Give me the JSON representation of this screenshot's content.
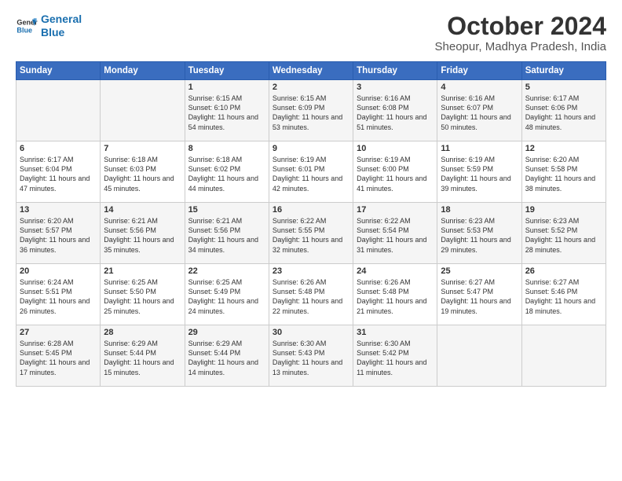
{
  "logo": {
    "line1": "General",
    "line2": "Blue"
  },
  "title": "October 2024",
  "location": "Sheopur, Madhya Pradesh, India",
  "days_of_week": [
    "Sunday",
    "Monday",
    "Tuesday",
    "Wednesday",
    "Thursday",
    "Friday",
    "Saturday"
  ],
  "weeks": [
    [
      {
        "day": "",
        "sunrise": "",
        "sunset": "",
        "daylight": ""
      },
      {
        "day": "",
        "sunrise": "",
        "sunset": "",
        "daylight": ""
      },
      {
        "day": "1",
        "sunrise": "Sunrise: 6:15 AM",
        "sunset": "Sunset: 6:10 PM",
        "daylight": "Daylight: 11 hours and 54 minutes."
      },
      {
        "day": "2",
        "sunrise": "Sunrise: 6:15 AM",
        "sunset": "Sunset: 6:09 PM",
        "daylight": "Daylight: 11 hours and 53 minutes."
      },
      {
        "day": "3",
        "sunrise": "Sunrise: 6:16 AM",
        "sunset": "Sunset: 6:08 PM",
        "daylight": "Daylight: 11 hours and 51 minutes."
      },
      {
        "day": "4",
        "sunrise": "Sunrise: 6:16 AM",
        "sunset": "Sunset: 6:07 PM",
        "daylight": "Daylight: 11 hours and 50 minutes."
      },
      {
        "day": "5",
        "sunrise": "Sunrise: 6:17 AM",
        "sunset": "Sunset: 6:06 PM",
        "daylight": "Daylight: 11 hours and 48 minutes."
      }
    ],
    [
      {
        "day": "6",
        "sunrise": "Sunrise: 6:17 AM",
        "sunset": "Sunset: 6:04 PM",
        "daylight": "Daylight: 11 hours and 47 minutes."
      },
      {
        "day": "7",
        "sunrise": "Sunrise: 6:18 AM",
        "sunset": "Sunset: 6:03 PM",
        "daylight": "Daylight: 11 hours and 45 minutes."
      },
      {
        "day": "8",
        "sunrise": "Sunrise: 6:18 AM",
        "sunset": "Sunset: 6:02 PM",
        "daylight": "Daylight: 11 hours and 44 minutes."
      },
      {
        "day": "9",
        "sunrise": "Sunrise: 6:19 AM",
        "sunset": "Sunset: 6:01 PM",
        "daylight": "Daylight: 11 hours and 42 minutes."
      },
      {
        "day": "10",
        "sunrise": "Sunrise: 6:19 AM",
        "sunset": "Sunset: 6:00 PM",
        "daylight": "Daylight: 11 hours and 41 minutes."
      },
      {
        "day": "11",
        "sunrise": "Sunrise: 6:19 AM",
        "sunset": "Sunset: 5:59 PM",
        "daylight": "Daylight: 11 hours and 39 minutes."
      },
      {
        "day": "12",
        "sunrise": "Sunrise: 6:20 AM",
        "sunset": "Sunset: 5:58 PM",
        "daylight": "Daylight: 11 hours and 38 minutes."
      }
    ],
    [
      {
        "day": "13",
        "sunrise": "Sunrise: 6:20 AM",
        "sunset": "Sunset: 5:57 PM",
        "daylight": "Daylight: 11 hours and 36 minutes."
      },
      {
        "day": "14",
        "sunrise": "Sunrise: 6:21 AM",
        "sunset": "Sunset: 5:56 PM",
        "daylight": "Daylight: 11 hours and 35 minutes."
      },
      {
        "day": "15",
        "sunrise": "Sunrise: 6:21 AM",
        "sunset": "Sunset: 5:56 PM",
        "daylight": "Daylight: 11 hours and 34 minutes."
      },
      {
        "day": "16",
        "sunrise": "Sunrise: 6:22 AM",
        "sunset": "Sunset: 5:55 PM",
        "daylight": "Daylight: 11 hours and 32 minutes."
      },
      {
        "day": "17",
        "sunrise": "Sunrise: 6:22 AM",
        "sunset": "Sunset: 5:54 PM",
        "daylight": "Daylight: 11 hours and 31 minutes."
      },
      {
        "day": "18",
        "sunrise": "Sunrise: 6:23 AM",
        "sunset": "Sunset: 5:53 PM",
        "daylight": "Daylight: 11 hours and 29 minutes."
      },
      {
        "day": "19",
        "sunrise": "Sunrise: 6:23 AM",
        "sunset": "Sunset: 5:52 PM",
        "daylight": "Daylight: 11 hours and 28 minutes."
      }
    ],
    [
      {
        "day": "20",
        "sunrise": "Sunrise: 6:24 AM",
        "sunset": "Sunset: 5:51 PM",
        "daylight": "Daylight: 11 hours and 26 minutes."
      },
      {
        "day": "21",
        "sunrise": "Sunrise: 6:25 AM",
        "sunset": "Sunset: 5:50 PM",
        "daylight": "Daylight: 11 hours and 25 minutes."
      },
      {
        "day": "22",
        "sunrise": "Sunrise: 6:25 AM",
        "sunset": "Sunset: 5:49 PM",
        "daylight": "Daylight: 11 hours and 24 minutes."
      },
      {
        "day": "23",
        "sunrise": "Sunrise: 6:26 AM",
        "sunset": "Sunset: 5:48 PM",
        "daylight": "Daylight: 11 hours and 22 minutes."
      },
      {
        "day": "24",
        "sunrise": "Sunrise: 6:26 AM",
        "sunset": "Sunset: 5:48 PM",
        "daylight": "Daylight: 11 hours and 21 minutes."
      },
      {
        "day": "25",
        "sunrise": "Sunrise: 6:27 AM",
        "sunset": "Sunset: 5:47 PM",
        "daylight": "Daylight: 11 hours and 19 minutes."
      },
      {
        "day": "26",
        "sunrise": "Sunrise: 6:27 AM",
        "sunset": "Sunset: 5:46 PM",
        "daylight": "Daylight: 11 hours and 18 minutes."
      }
    ],
    [
      {
        "day": "27",
        "sunrise": "Sunrise: 6:28 AM",
        "sunset": "Sunset: 5:45 PM",
        "daylight": "Daylight: 11 hours and 17 minutes."
      },
      {
        "day": "28",
        "sunrise": "Sunrise: 6:29 AM",
        "sunset": "Sunset: 5:44 PM",
        "daylight": "Daylight: 11 hours and 15 minutes."
      },
      {
        "day": "29",
        "sunrise": "Sunrise: 6:29 AM",
        "sunset": "Sunset: 5:44 PM",
        "daylight": "Daylight: 11 hours and 14 minutes."
      },
      {
        "day": "30",
        "sunrise": "Sunrise: 6:30 AM",
        "sunset": "Sunset: 5:43 PM",
        "daylight": "Daylight: 11 hours and 13 minutes."
      },
      {
        "day": "31",
        "sunrise": "Sunrise: 6:30 AM",
        "sunset": "Sunset: 5:42 PM",
        "daylight": "Daylight: 11 hours and 11 minutes."
      },
      {
        "day": "",
        "sunrise": "",
        "sunset": "",
        "daylight": ""
      },
      {
        "day": "",
        "sunrise": "",
        "sunset": "",
        "daylight": ""
      }
    ]
  ]
}
